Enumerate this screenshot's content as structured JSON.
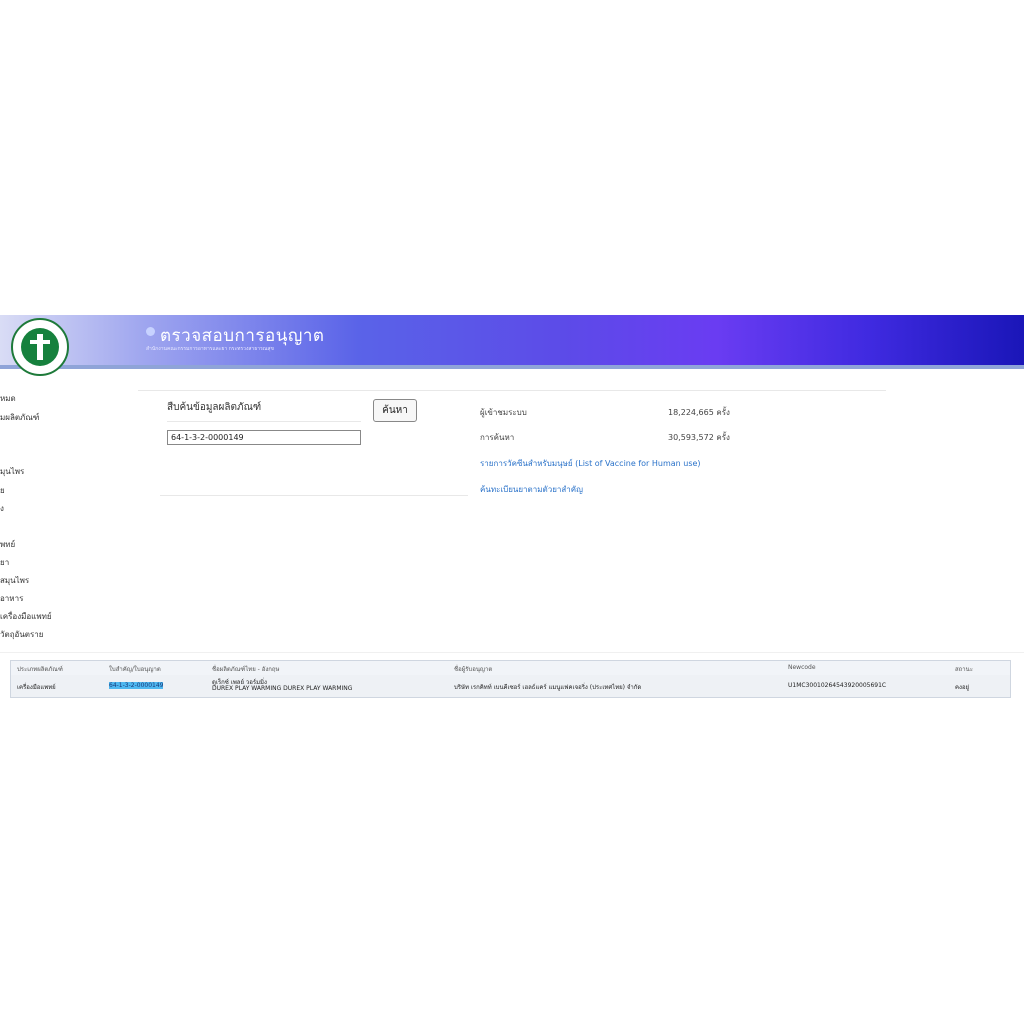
{
  "header": {
    "title": "ตรวจสอบการอนุญาต",
    "subtitle": "สำนักงานคณะกรรมการอาหารและยา กระทรวงสาธารณสุข",
    "logo_text": "MINISTRY OF PUBLIC HEALTH"
  },
  "sidebar": {
    "items": [
      "หมด",
      "มผลิตภัณฑ์",
      "มุนไพร",
      "ย",
      "ง",
      "พทย์",
      "ยา",
      "สมุนไพร",
      "อาหาร",
      "เครื่องมือแพทย์",
      "วัตถุอันตราย"
    ]
  },
  "search": {
    "label": "สืบค้นข้อมูลผลิตภัณฑ์",
    "button": "ค้นหา",
    "value": "64-1-3-2-0000149"
  },
  "stats": {
    "visitors_label": "ผู้เข้าชมระบบ",
    "visitors_value": "18,224,665 ครั้ง",
    "searches_label": "การค้นหา",
    "searches_value": "30,593,572 ครั้ง"
  },
  "links": {
    "vaccine": "รายการวัคซีนสำหรับมนุษย์ (List of Vaccine for Human use)",
    "drug_search": "ค้นทะเบียนยาตามตัวยาสำคัญ"
  },
  "table": {
    "headers": [
      "ประเภทผลิตภัณฑ์",
      "ใบสำคัญ/ใบอนุญาต",
      "ชื่อผลิตภัณฑ์ไทย - อังกฤษ",
      "ชื่อผู้รับอนุญาต",
      "Newcode",
      "สถานะ"
    ],
    "row": {
      "type": "เครื่องมือแพทย์",
      "license": "64-1-3-2-0000149",
      "name_th": "ดูเร็กซ์ เพลย์ วอร์มมิ่ง",
      "name_en": "DUREX PLAY WARMING DUREX PLAY WARMING",
      "licensee": "บริษัท เรกคิทท์ เบนคีเซอร์ เฮลธ์แคร์ แมนูแฟคเจอริ่ง (ประเทศไทย) จำกัด",
      "newcode": "U1MC30010264543920005691C",
      "status": "คงอยู่"
    }
  }
}
